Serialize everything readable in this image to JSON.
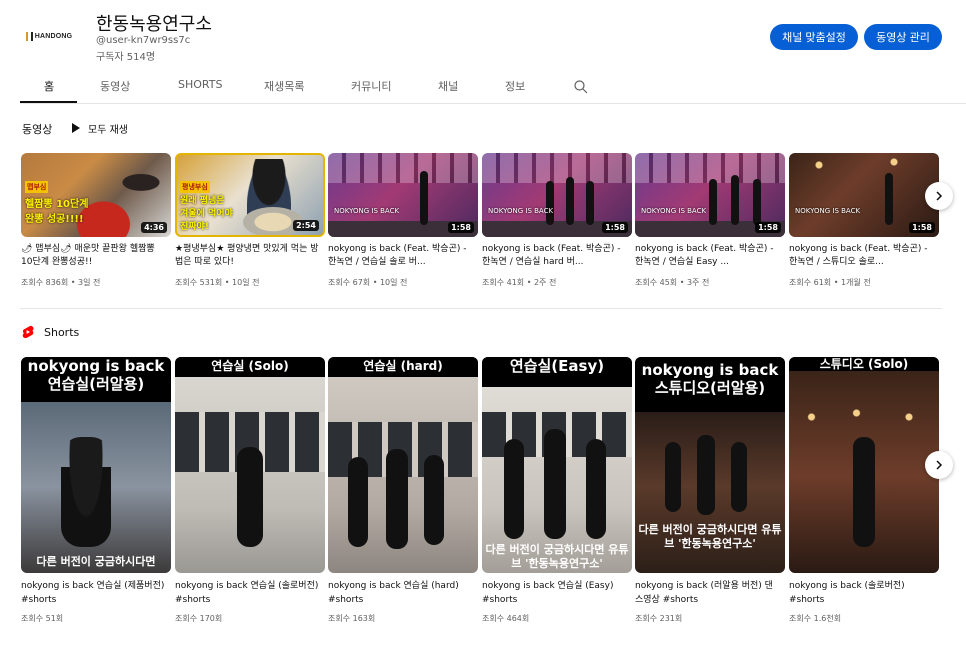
{
  "channel": {
    "logo_text": "HANDONG",
    "name": "한동녹용연구소",
    "handle": "@user-kn7wr9ss7c",
    "subscribers": "구독자 514명"
  },
  "buttons": {
    "customize": "채널 맞춤설정",
    "manage": "동영상 관리"
  },
  "tabs": [
    "홈",
    "동영상",
    "SHORTS",
    "재생목록",
    "커뮤니티",
    "채널",
    "정보"
  ],
  "videos_section": {
    "title": "동영상",
    "play_all": "모두 재생",
    "videos": [
      {
        "title": "🌶 맵부심🌶 매운맛 끝판왕 헬짬뽕 10단계 완뽕성공!!",
        "meta": "조회수 836회 • 3일 전",
        "duration": "4:36",
        "overlay_lines": [
          "맵부심",
          "헬짬뽕 10단계",
          "완뽕 성공!!!!"
        ]
      },
      {
        "title": "★평냉부심★ 평양냉면 맛있게 먹는 방법은 따로 있다!",
        "meta": "조회수 531회 • 10일 전",
        "duration": "2:54",
        "overlay_lines": [
          "평냉부심",
          "원래 평냉은",
          "겨울에 먹어야",
          "진짜야!"
        ]
      },
      {
        "title": "nokyong is back (Feat. 박승곤) - 한녹연 / 연습실 솔로 버...",
        "meta": "조회수 67회 • 10일 전",
        "duration": "1:58",
        "overlay_lines": [
          "NOKYONG IS BACK"
        ]
      },
      {
        "title": "nokyong is back (Feat. 박승곤) - 한녹연 / 연습실 hard 버...",
        "meta": "조회수 41회 • 2주 전",
        "duration": "1:58",
        "overlay_lines": [
          "NOKYONG IS BACK"
        ]
      },
      {
        "title": "nokyong is back (Feat. 박승곤) - 한녹연 / 연습실 Easy ...",
        "meta": "조회수 45회 • 3주 전",
        "duration": "1:58",
        "overlay_lines": [
          "NOKYONG IS BACK"
        ]
      },
      {
        "title": "nokyong is back (Feat. 박승곤) - 한녹연 / 스튜디오 솔로...",
        "meta": "조회수 61회 • 1개월 전",
        "duration": "1:58",
        "overlay_lines": [
          "NOKYONG IS BACK"
        ]
      }
    ]
  },
  "shorts_section": {
    "title": "Shorts",
    "shorts": [
      {
        "title": "nokyong is back 연습실 (제품버전) #shorts",
        "meta": "조회수 51회",
        "caption_top": "nokyong is back 연습실(러알용)",
        "caption_bottom": "다른 버전이 궁금하시다면"
      },
      {
        "title": "nokyong is back 연습실 (솔로버전) #shorts",
        "meta": "조회수 170회",
        "caption_top": "연습실 (Solo)",
        "caption_bottom": ""
      },
      {
        "title": "nokyong is back 연습실 (hard) #shorts",
        "meta": "조회수 163회",
        "caption_top": "연습실 (hard)",
        "caption_bottom": ""
      },
      {
        "title": "nokyong is back 연습실 (Easy) #shorts",
        "meta": "조회수 464회",
        "caption_top": "연습실(Easy)",
        "caption_bottom": "다른 버전이 궁금하시다면 유튜브 '한동녹용연구소'"
      },
      {
        "title": "nokyong is back (러알용 버전) 댄스영상 #shorts",
        "meta": "조회수 231회",
        "caption_top": "nokyong is back 스튜디오(러알용)",
        "caption_bottom": "다른 버전이 궁금하시다면 유튜브 '한동녹용연구소'"
      },
      {
        "title": "nokyong is back (솔로버전) #shorts",
        "meta": "조회수 1.6천회",
        "caption_top": "스튜디오 (Solo)",
        "caption_bottom": ""
      }
    ]
  }
}
